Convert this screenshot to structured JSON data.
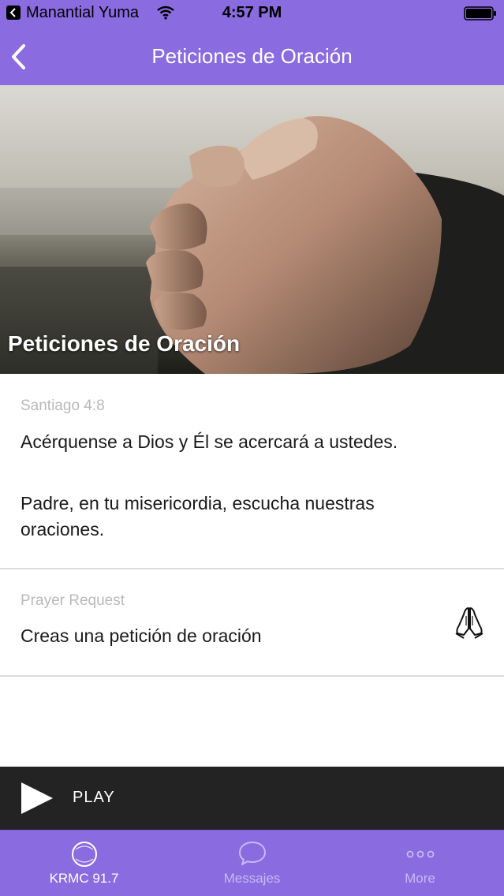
{
  "status_bar": {
    "carrier": "Manantial Yuma",
    "time": "4:57 PM"
  },
  "nav": {
    "title": "Peticiones de Oración"
  },
  "hero": {
    "title": "Peticiones de Oración"
  },
  "verse": {
    "reference": "Santiago 4:8",
    "text": "Acérquense a Dios y Él se acercará a ustedes.",
    "prayer": "Padre, en tu misericordia, escucha nuestras oraciones."
  },
  "request": {
    "eyebrow": "Prayer Request",
    "label": "Creas una petición de oración"
  },
  "player": {
    "play_label": "PLAY"
  },
  "tabs": [
    {
      "label": "KRMC 91.7",
      "icon": "radio-circle-icon",
      "active": true
    },
    {
      "label": "Messajes",
      "icon": "chat-bubble-icon",
      "active": false
    },
    {
      "label": "More",
      "icon": "more-dots-icon",
      "active": false
    }
  ],
  "colors": {
    "brand": "#8a6be0",
    "player_bg": "#232323",
    "tab_active": "#ffffff",
    "tab_inactive": "#c9b8f5"
  }
}
